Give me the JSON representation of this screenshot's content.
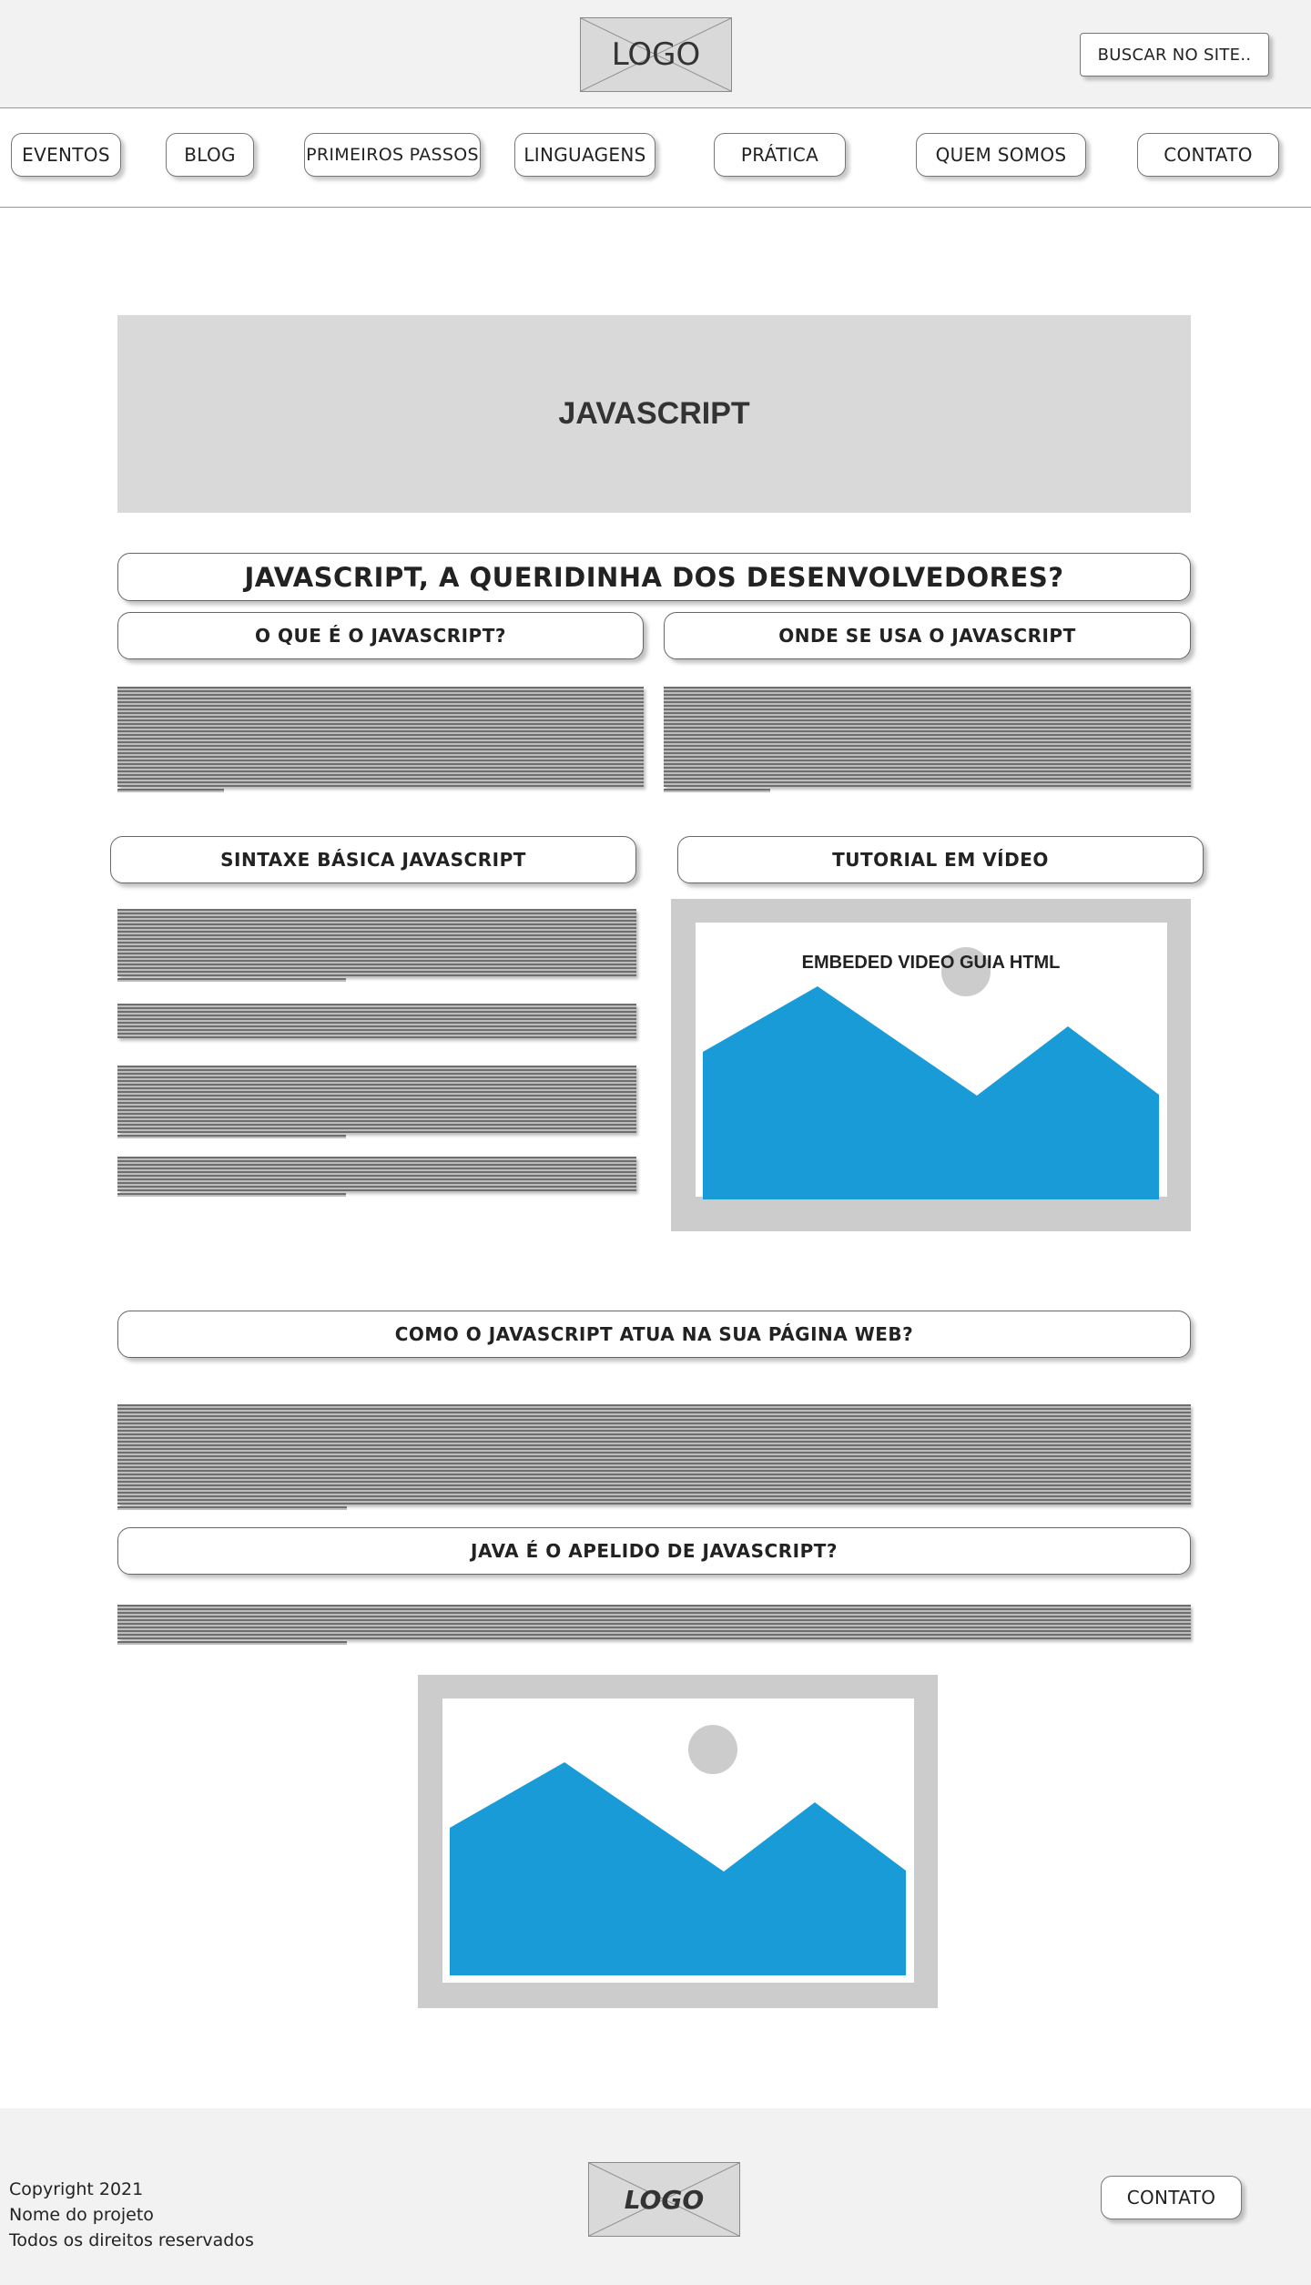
{
  "header": {
    "logo_text": "LOGO",
    "search_label": "BUSCAR NO SITE.."
  },
  "nav": {
    "items": [
      {
        "label": "EVENTOS"
      },
      {
        "label": "BLOG"
      },
      {
        "label": "PRIMEIROS PASSOS"
      },
      {
        "label": "LINGUAGENS"
      },
      {
        "label": "PRÁTICA"
      },
      {
        "label": "QUEM SOMOS"
      },
      {
        "label": "CONTATO"
      }
    ]
  },
  "banner": {
    "title": "JAVASCRIPT"
  },
  "sections": {
    "main_heading": "JAVASCRIPT, A QUERIDINHA DOS DESENVOLVEDORES?",
    "what_is": "O QUE É O JAVASCRIPT?",
    "where_used": "ONDE SE USA O JAVASCRIPT",
    "syntax": "SINTAXE BÁSICA JAVASCRIPT",
    "video_tutorial": "TUTORIAL EM VÍDEO",
    "how_acts": "COMO O JAVASCRIPT ATUA NA SUA PÁGINA WEB?",
    "java_nickname": "JAVA É O APELIDO DE JAVASCRIPT?"
  },
  "video": {
    "caption": "EMBEDED VIDEO GUIA HTML"
  },
  "footer": {
    "lines": [
      "Copyright 2021",
      "Nome do projeto",
      "Todos os direitos reservados"
    ],
    "logo_text": "LOGO",
    "contact_label": "CONTATO"
  },
  "colors": {
    "page_gray": "#f2f2f2",
    "banner_gray": "#d9d9d9",
    "image_frame": "#cccccc",
    "mountain_blue": "#189bd7"
  }
}
